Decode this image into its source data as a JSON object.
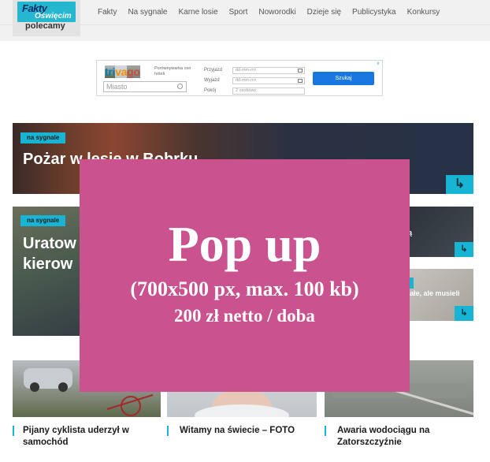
{
  "logo": {
    "line1": "Fakty",
    "line2": "Oświęcim",
    "subtitle": "polecamy"
  },
  "nav": {
    "items": [
      "Fakty",
      "Na sygnale",
      "Karne losie",
      "Sport",
      "Noworodki",
      "Dzieje się",
      "Publicystyka",
      "Konkursy"
    ]
  },
  "ad": {
    "brand": [
      "tri",
      "va",
      "go"
    ],
    "tagline": "Porównywarka cen hoteli",
    "search_placeholder": "Miasto",
    "checkin_label": "Przyjazd",
    "checkout_label": "Wyjazd",
    "room_label": "Pokój",
    "date_placeholder": "dd-mm-rrrr",
    "room_value": "2 osobowy",
    "button": "Szukaj",
    "close": "x"
  },
  "hero": {
    "badge": "na sygnale",
    "title": "Pożar w lesie w Bobrku",
    "arrow": "↳"
  },
  "card_left": {
    "badge": "na sygnale",
    "title_line1": "Uratow",
    "title_line2": "kierow"
  },
  "card_r1": {
    "text": "ą",
    "arrow": "↳"
  },
  "card_r2": {
    "badge": "",
    "text": "ałe, ale musieli",
    "arrow": "↳"
  },
  "thumbs": [
    {
      "caption_line1": "Pijany cyklista uderzył w",
      "caption_line2": "samochód"
    },
    {
      "caption_line1": "Witamy na świecie – FOTO",
      "caption_line2": ""
    },
    {
      "caption_line1": "Awaria wodociągu na",
      "caption_line2": "Zatorszczyźnie"
    }
  ],
  "popup": {
    "title": "Pop up",
    "subtitle": "(700x500 px, max. 100 kb)",
    "price": "200 zł netto / doba",
    "color": "#c9528f"
  },
  "colors": {
    "accent": "#17b5d3"
  }
}
